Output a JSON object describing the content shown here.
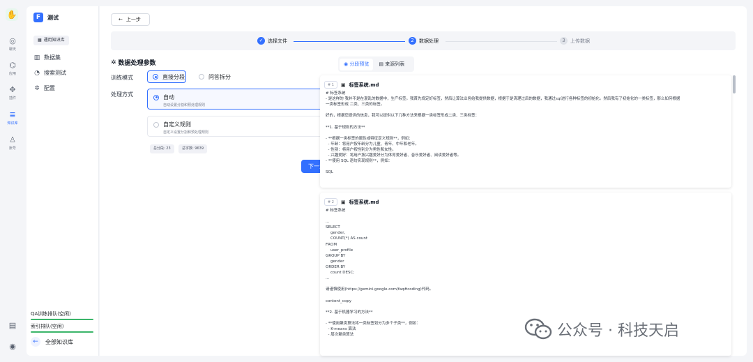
{
  "rail": {
    "items": [
      {
        "icon": "chat-icon",
        "label": "聊天"
      },
      {
        "icon": "robot-icon",
        "label": "应用"
      },
      {
        "icon": "puzzle-icon",
        "label": "插件"
      },
      {
        "icon": "database-icon",
        "label": "知识库"
      },
      {
        "icon": "user-icon",
        "label": "账号"
      }
    ]
  },
  "sidebar": {
    "kb_name": "测试",
    "kb_tag": "通用知识库",
    "nav": [
      {
        "icon": "dataset-icon",
        "label": "数据集"
      },
      {
        "icon": "search-test-icon",
        "label": "搜索测试"
      },
      {
        "icon": "settings-icon",
        "label": "配置"
      }
    ],
    "queues": [
      "QA训练排队(空闲)",
      "索引排队(空闲)"
    ],
    "back_all": "全部知识库"
  },
  "header": {
    "back_label": "上一步"
  },
  "steps": [
    {
      "index": "✓",
      "label": "选择文件",
      "state": "done"
    },
    {
      "index": "2",
      "label": "数据处理",
      "state": "active"
    },
    {
      "index": "3",
      "label": "上传数据",
      "state": "todo"
    }
  ],
  "params": {
    "title": "数据处理参数",
    "train_mode_label": "训练模式",
    "train_modes": [
      "直接分段",
      "问答拆分"
    ],
    "process_label": "处理方式",
    "methods": [
      {
        "title": "自动",
        "desc": "自动设置分割和预处理规则"
      },
      {
        "title": "自定义规则",
        "desc": "自定义设置分割和预处理规则"
      }
    ],
    "total_chunks": "总分段: 23",
    "total_chars": "总字数: 9639",
    "next_label": "下一步"
  },
  "preview": {
    "tabs": [
      "分段预览",
      "来源列表"
    ],
    "chunks": [
      {
        "index": "# 1",
        "file": "标签系统.md",
        "lines": [
          "# 标签系统",
          "- 是这样的 我并不是在混乱的数据中，生产标签。我首先规定好标签，然后让算法业务给我提供数据，根据于是清理过后的数据，我通过sql进行各种标签的初始化。然后我有了初始化的一类标签，那么如何根据",
          "一类标签形成 二类、三类的标签。",
          "",
          "好的，根据您提供的信息，我可以提供以下几种方法来根据一类标签形成二类、三类标签：",
          "",
          "**1. 基于规则的方法**",
          "",
          "- **根据一类标签的属性或特征定义规则**，例如：",
          "  - 年龄：将用户按年龄分为儿童、青年、中年和老年。",
          "  - 性别：将用户按性别分为男性和女性。",
          "  - 兴趣爱好：将用户按兴趣爱好分为体育爱好者、音乐爱好者、阅读爱好者等。",
          "- **使用 SQL 语句实现规则**，例如：",
          "",
          "SQL"
        ]
      },
      {
        "index": "# 2",
        "file": "标签系统.md",
        "lines": [
          "# 标签系统",
          "",
          "...",
          "SELECT",
          "    gender,",
          "    COUNT(*) AS count",
          "FROM",
          "    user_profile",
          "GROUP BY",
          "    gender",
          "ORDER BY",
          "    count DESC;",
          "...",
          "",
          "请谨慎使用(https://gemini.google.com/faq#coding)代码。",
          "",
          "content_copy",
          "",
          "**2. 基于机器学习的方法**",
          "",
          "- **使用聚类算法将一类标签划分为多个子类**，例如：",
          "  - K-means 算法",
          "  - 层次聚类算法"
        ]
      }
    ]
  },
  "watermark": {
    "text": "公众号 · 科技天启"
  },
  "colors": {
    "accent": "#3370ff",
    "queue_bar": "#3bb56a"
  }
}
